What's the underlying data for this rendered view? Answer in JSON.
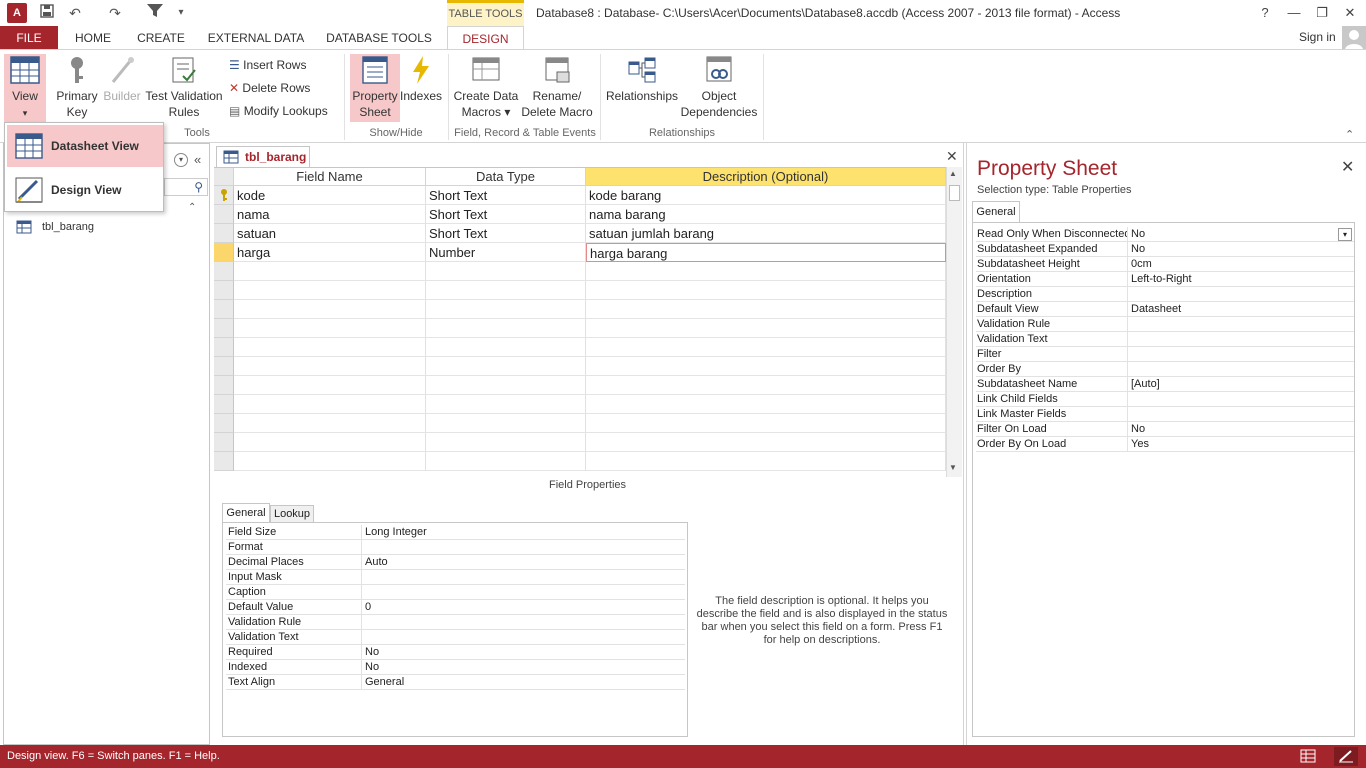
{
  "app": {
    "icon_text": "A",
    "window_title": "Database8 : Database- C:\\Users\\Acer\\Documents\\Database8.accdb (Access 2007 - 2013 file format) - Access",
    "contextual_tab": "TABLE TOOLS",
    "sign_in": "Sign in",
    "help_glyph": "?"
  },
  "tabs": [
    "FILE",
    "HOME",
    "CREATE",
    "EXTERNAL DATA",
    "DATABASE TOOLS",
    "DESIGN"
  ],
  "ribbon": {
    "view": "View",
    "primary_key_1": "Primary",
    "primary_key_2": "Key",
    "builder": "Builder",
    "test_1": "Test Validation",
    "test_2": "Rules",
    "insert_rows": "Insert Rows",
    "delete_rows": "Delete Rows",
    "modify_lookups": "Modify Lookups",
    "tools_label": "Tools",
    "property_sheet_1": "Property",
    "property_sheet_2": "Sheet",
    "indexes": "Indexes",
    "showhide_label": "Show/Hide",
    "create_macros_1": "Create Data",
    "create_macros_2": "Macros ▾",
    "rename_macro_1": "Rename/",
    "rename_macro_2": "Delete Macro",
    "events_label": "Field, Record & Table Events",
    "relationships": "Relationships",
    "object_dep_1": "Object",
    "object_dep_2": "Dependencies",
    "relationships_label": "Relationships"
  },
  "view_menu": {
    "datasheet": "Datasheet View",
    "design": "Design View"
  },
  "nav": {
    "table_name": "tbl_barang"
  },
  "document": {
    "tab_label": "tbl_barang",
    "headers": [
      "Field Name",
      "Data Type",
      "Description (Optional)"
    ],
    "rows": [
      {
        "name": "kode",
        "type": "Short Text",
        "desc": "kode barang"
      },
      {
        "name": "nama",
        "type": "Short Text",
        "desc": "nama barang"
      },
      {
        "name": "satuan",
        "type": "Short Text",
        "desc": "satuan jumlah barang"
      },
      {
        "name": "harga",
        "type": "Number",
        "desc": "harga barang"
      }
    ]
  },
  "field_properties": {
    "label": "Field Properties",
    "tab_general": "General",
    "tab_lookup": "Lookup",
    "rows": [
      {
        "k": "Field Size",
        "v": "Long Integer"
      },
      {
        "k": "Format",
        "v": ""
      },
      {
        "k": "Decimal Places",
        "v": "Auto"
      },
      {
        "k": "Input Mask",
        "v": ""
      },
      {
        "k": "Caption",
        "v": ""
      },
      {
        "k": "Default Value",
        "v": "0"
      },
      {
        "k": "Validation Rule",
        "v": ""
      },
      {
        "k": "Validation Text",
        "v": ""
      },
      {
        "k": "Required",
        "v": "No"
      },
      {
        "k": "Indexed",
        "v": "No"
      },
      {
        "k": "Text Align",
        "v": "General"
      }
    ],
    "help": "The field description is optional. It helps you describe the field and is also displayed in the status bar when you select this field on a form. Press F1 for help on descriptions."
  },
  "property_sheet": {
    "title": "Property Sheet",
    "selection": "Selection type:  Table Properties",
    "tab": "General",
    "rows": [
      {
        "k": "Read Only When Disconnected",
        "v": "No"
      },
      {
        "k": "Subdatasheet Expanded",
        "v": "No"
      },
      {
        "k": "Subdatasheet Height",
        "v": "0cm"
      },
      {
        "k": "Orientation",
        "v": "Left-to-Right"
      },
      {
        "k": "Description",
        "v": ""
      },
      {
        "k": "Default View",
        "v": "Datasheet"
      },
      {
        "k": "Validation Rule",
        "v": ""
      },
      {
        "k": "Validation Text",
        "v": ""
      },
      {
        "k": "Filter",
        "v": ""
      },
      {
        "k": "Order By",
        "v": ""
      },
      {
        "k": "Subdatasheet Name",
        "v": "[Auto]"
      },
      {
        "k": "Link Child Fields",
        "v": ""
      },
      {
        "k": "Link Master Fields",
        "v": ""
      },
      {
        "k": "Filter On Load",
        "v": "No"
      },
      {
        "k": "Order By On Load",
        "v": "Yes"
      }
    ]
  },
  "status": {
    "text": "Design view.  F6 = Switch panes.  F1 = Help."
  },
  "colors": {
    "accent": "#a4262c",
    "contextual": "#e8b800",
    "header_highlight": "#fde36e"
  }
}
